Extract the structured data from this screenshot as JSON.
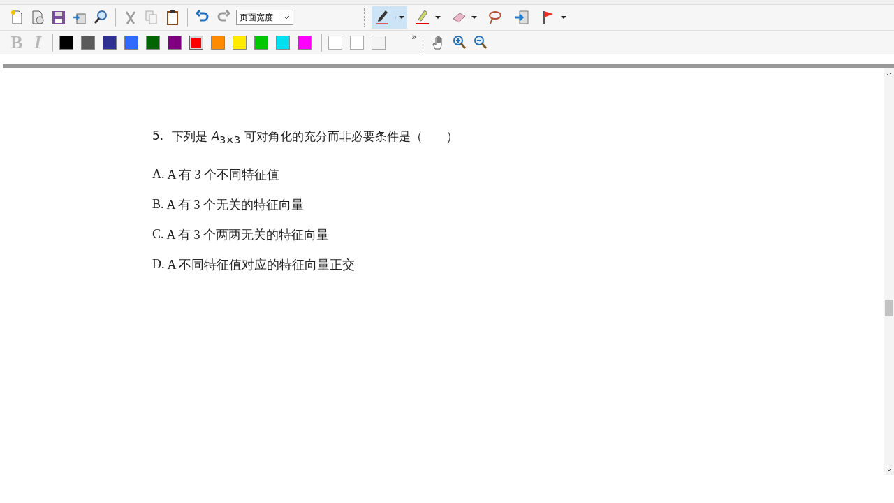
{
  "toolbar": {
    "zoom_select": {
      "value": "页面宽度"
    },
    "tools": [
      {
        "kind": "pen",
        "selected": true,
        "menu": true
      },
      {
        "kind": "highlighter",
        "selected": false,
        "menu": true
      },
      {
        "kind": "eraser",
        "selected": false,
        "menu": true
      },
      {
        "kind": "lasso",
        "selected": false,
        "menu": false
      },
      {
        "kind": "insert",
        "selected": false,
        "menu": false
      },
      {
        "kind": "flag",
        "selected": false,
        "menu": true
      }
    ]
  },
  "format_bar": {
    "bold": {
      "label": "B",
      "disabled": true
    },
    "italic": {
      "label": "I",
      "disabled": true
    },
    "colors": [
      {
        "color": "#000000",
        "selected": false
      },
      {
        "color": "#5a5a5a",
        "selected": false
      },
      {
        "color": "#2e3192",
        "selected": false
      },
      {
        "color": "#2f6bff",
        "selected": false
      },
      {
        "color": "#006400",
        "selected": false
      },
      {
        "color": "#7f007f",
        "selected": false
      },
      {
        "color": "#ff0000",
        "selected": true
      },
      {
        "color": "#ff8c00",
        "selected": false
      },
      {
        "color": "#ffea00",
        "selected": false
      },
      {
        "color": "#00c800",
        "selected": false
      },
      {
        "color": "#00e0f0",
        "selected": false
      },
      {
        "color": "#ff00ff",
        "selected": false
      }
    ],
    "custom_colors": [
      {
        "color": "#ffffff",
        "selected": false
      },
      {
        "color": "#ffffff",
        "selected": false
      },
      {
        "color": "#f4f4f4",
        "selected": false
      }
    ],
    "overflow": "»"
  },
  "document": {
    "question": {
      "number": "5.",
      "text": "下列是 *A*$_{3×3}$ 可对角化的充分而非必要条件是（　　）"
    },
    "options": [
      {
        "label": "A.",
        "text": "A 有 3 个不同特征值"
      },
      {
        "label": "B.",
        "text": "A 有 3 个无关的特征向量"
      },
      {
        "label": "C.",
        "text": "A 有 3 个两两无关的特征向量"
      },
      {
        "label": "D.",
        "text": "A 不同特征值对应的特征向量正交"
      }
    ]
  }
}
